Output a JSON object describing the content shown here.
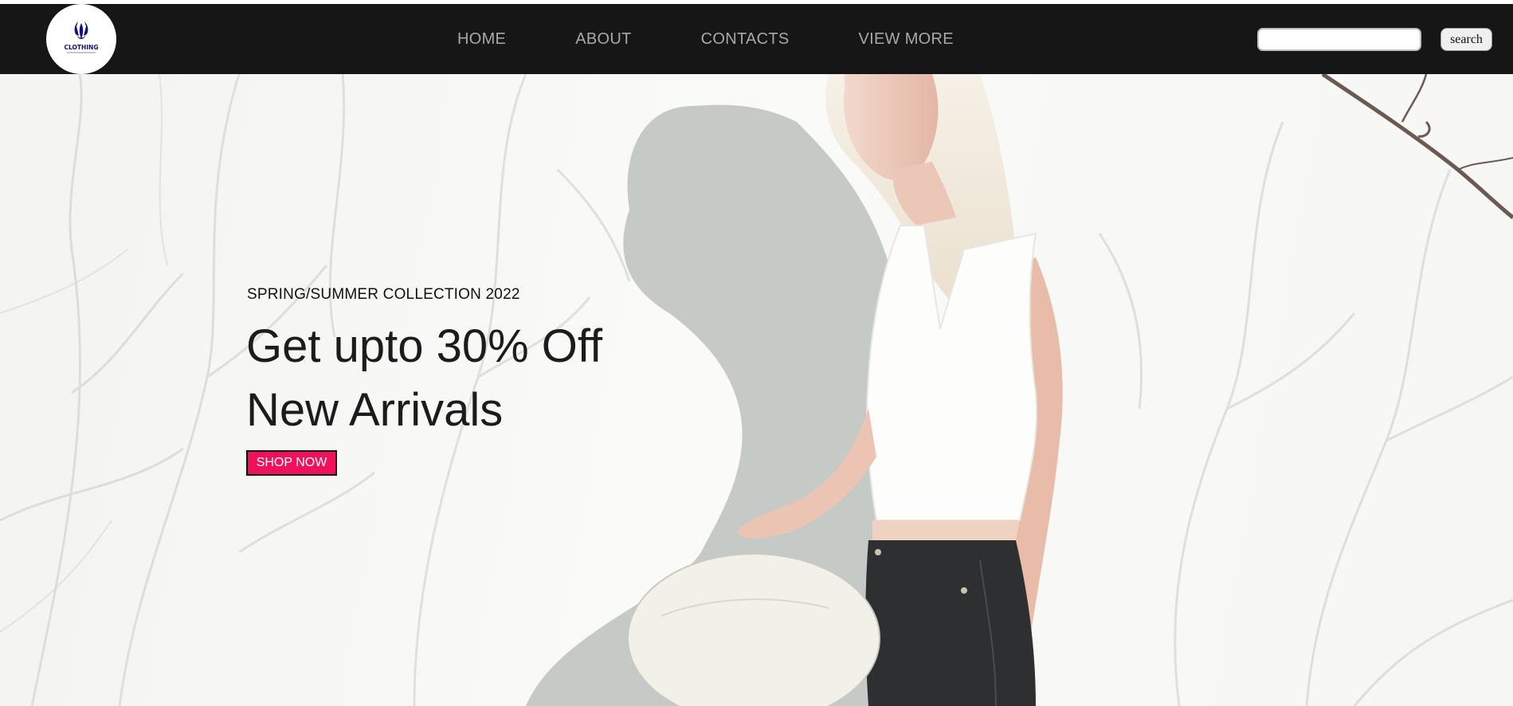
{
  "header": {
    "logo_text": "CLOTHING",
    "nav": [
      "HOME",
      "ABOUT",
      "CONTACTS",
      "VIEW MORE"
    ],
    "search": {
      "value": "",
      "placeholder": "",
      "button_label": "search"
    }
  },
  "hero": {
    "subtitle": "SPRING/SUMMER COLLECTION 2022",
    "headline_line1": "Get upto 30% Off",
    "headline_line2": "New Arrivals",
    "cta_label": "SHOP NOW"
  },
  "colors": {
    "navbar_bg": "#161616",
    "nav_link": "#a8a8a8",
    "cta_bg": "#f0115c",
    "logo_accent": "#12127a"
  },
  "icons": {
    "logo": "clothing-brand-logo"
  }
}
